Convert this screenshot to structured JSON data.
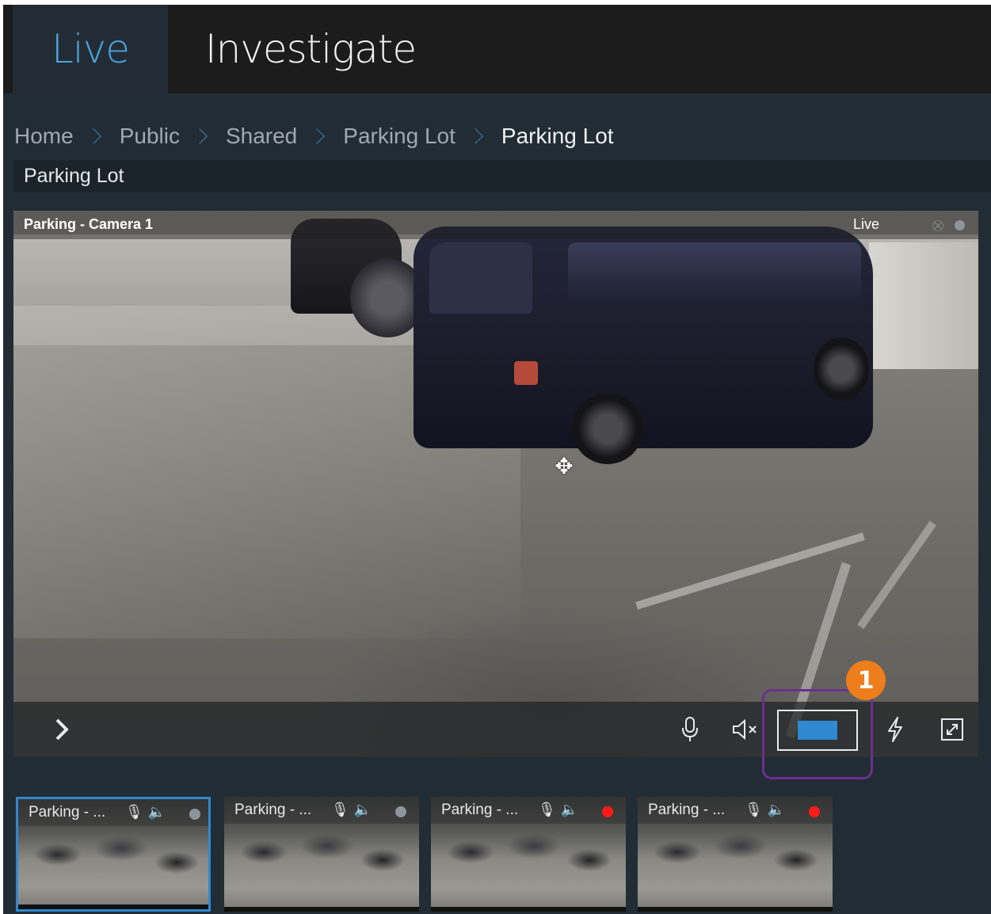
{
  "nav": {
    "tabs": [
      {
        "label": "Live"
      },
      {
        "label": "Investigate"
      }
    ]
  },
  "breadcrumb": {
    "items": [
      "Home",
      "Public",
      "Shared",
      "Parking Lot",
      "Parking Lot"
    ]
  },
  "view": {
    "title": "Parking Lot"
  },
  "main_tile": {
    "camera_name": "Parking - Camera 1",
    "mode_label": "Live",
    "toolbar": {
      "expand_icon": "chevron-right-icon",
      "mic_icon": "microphone-icon",
      "speaker_icon": "speaker-muted-icon",
      "quality_icon": "stream-quality-icon",
      "flash_icon": "lightning-icon",
      "fullscreen_icon": "fullscreen-icon"
    }
  },
  "callout": {
    "number": "1",
    "color": "#ee7d1b",
    "outline_color": "#6b2f8f"
  },
  "thumbnails": [
    {
      "name": "Parking - ...",
      "status": "grey",
      "selected": true
    },
    {
      "name": "Parking - ...",
      "status": "grey",
      "selected": false
    },
    {
      "name": "Parking - ...",
      "status": "red",
      "selected": false
    },
    {
      "name": "Parking - ...",
      "status": "red",
      "selected": false
    }
  ],
  "colors": {
    "accent": "#2f88d0",
    "live_tab": "#4aa3de",
    "recording": "#ff1a1a"
  }
}
